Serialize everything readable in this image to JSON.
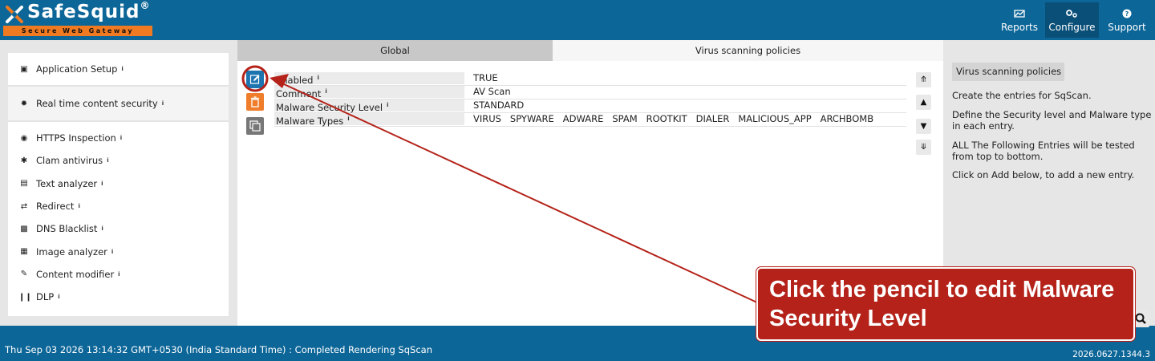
{
  "header": {
    "logo_text": "SafeSquid",
    "logo_reg": "®",
    "logo_tagline": "Secure Web Gateway",
    "nav": [
      {
        "icon": "chart-icon",
        "label": "Reports"
      },
      {
        "icon": "gears-icon",
        "label": "Configure"
      },
      {
        "icon": "question-icon",
        "label": "Support"
      }
    ]
  },
  "sidebar": {
    "sections": [
      {
        "icon": "briefcase-icon",
        "label": "Application Setup"
      },
      {
        "icon": "bug-icon",
        "label": "Real time content security"
      }
    ],
    "items": [
      {
        "icon": "eye-icon",
        "label": "HTTPS Inspection"
      },
      {
        "icon": "asterisk-icon",
        "label": "Clam antivirus"
      },
      {
        "icon": "file-word-icon",
        "label": "Text analyzer"
      },
      {
        "icon": "random-icon",
        "label": "Redirect"
      },
      {
        "icon": "dns-icon",
        "label": "DNS Blacklist"
      },
      {
        "icon": "image-icon",
        "label": "Image analyzer"
      },
      {
        "icon": "edit-icon",
        "label": "Content modifier"
      },
      {
        "icon": "barcode-icon",
        "label": "DLP"
      }
    ]
  },
  "tabs": [
    {
      "label": "Global"
    },
    {
      "label": "Virus scanning policies"
    }
  ],
  "entry": {
    "rows": [
      {
        "key": "Enabled",
        "value": "TRUE"
      },
      {
        "key": "Comment",
        "value": "AV Scan"
      },
      {
        "key": "Malware Security Level",
        "value": "STANDARD"
      },
      {
        "key": "Malware Types",
        "value": "VIRUS   SPYWARE   ADWARE   SPAM   ROOTKIT   DIALER   MALICIOUS_APP   ARCHBOMB"
      }
    ]
  },
  "help": {
    "title": "Virus scanning policies",
    "lines": [
      "Create the entries for SqScan.",
      "Define the Security level and Malware type in each entry.",
      "ALL The Following Entries will be tested from top to bottom.",
      "Click on Add below, to add a new entry."
    ]
  },
  "footer": {
    "status": "Thu Sep 03 2026 13:14:32 GMT+0530 (India Standard Time) : Completed Rendering SqScan",
    "version": "2026.0627.1344.3"
  },
  "annotation": {
    "text": "Click the pencil to edit Malware Security Level"
  },
  "colors": {
    "header_bg": "#0d6698",
    "accent_orange": "#ef7d2b",
    "edit_blue": "#1d75b0",
    "annotation_red": "#b42219"
  }
}
